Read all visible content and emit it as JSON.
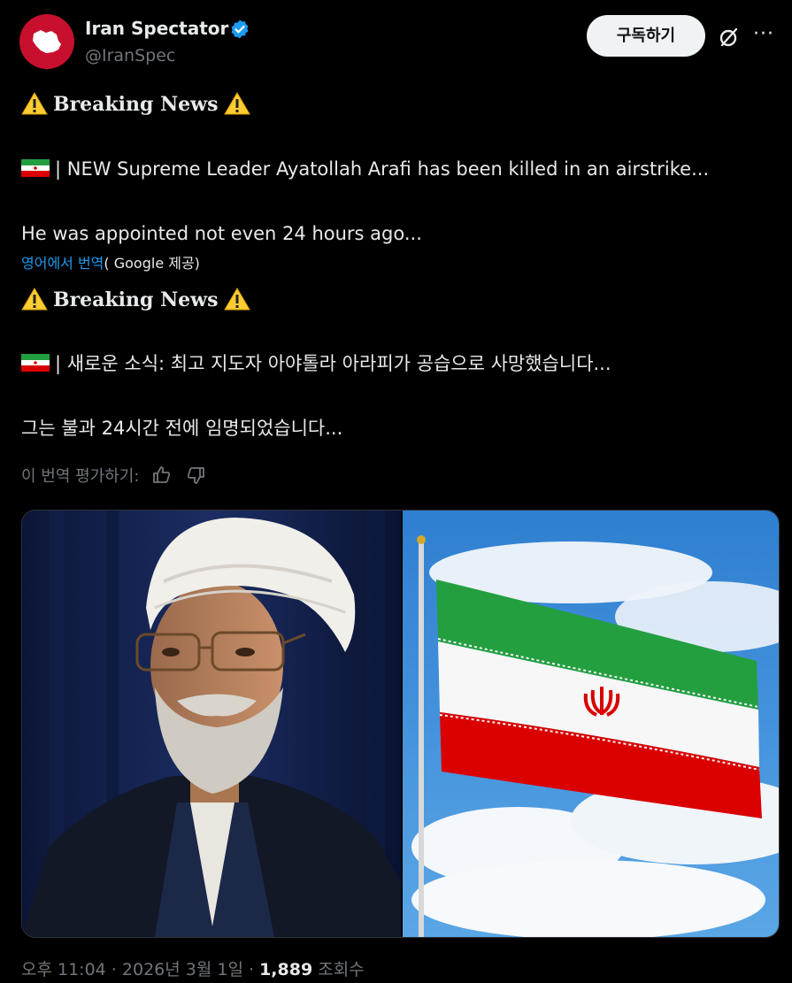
{
  "author": {
    "name": "Iran Spectator",
    "handle": "@IranSpec",
    "verified_color": "#1d9bf0",
    "avatar": "red-circle-iran-map-logo"
  },
  "header": {
    "subscribe_label": "구독하기",
    "grok_icon": "grok-icon",
    "more_icon": "ellipsis-icon"
  },
  "tweet": {
    "original": {
      "headline": "Breaking News",
      "line1": "| NEW Supreme Leader Ayatollah Arafi has been killed in an airstrike...",
      "line2": "He was appointed not even 24 hours ago..."
    },
    "translation_note": {
      "link": "영어에서 번역",
      "provider": "( Google 제공)"
    },
    "translated": {
      "headline": "Breaking News",
      "line1": "| 새로운 소식: 최고 지도자 아야톨라 아라피가 공습으로 사망했습니다...",
      "line2": "그는 불과 24시간 전에 임명되었습니다..."
    },
    "rate_translation": "이 번역 평가하기:"
  },
  "media": {
    "left_image": "photo of cleric in white turban and glasses",
    "right_image": "Iranian flag waving against blue sky"
  },
  "meta": {
    "time": "오후 11:04",
    "sep1": " · ",
    "date": "2026년 3월 1일",
    "sep2": " · ",
    "views": "1,889",
    "views_label": " 조회수"
  },
  "colors": {
    "background": "#000000",
    "text": "#e7e9ea",
    "muted": "#71767b",
    "link": "#1d9bf0",
    "flag_green": "#239f40",
    "flag_red": "#da0000"
  }
}
